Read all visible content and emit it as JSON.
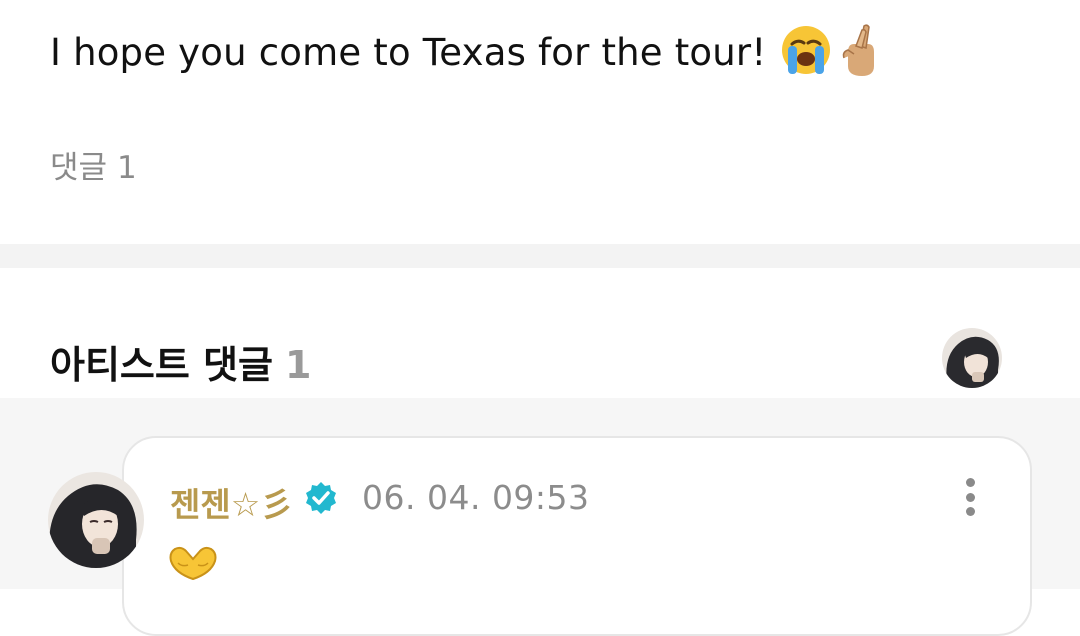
{
  "post": {
    "text": "I hope you come to Texas for the tour!",
    "emojis": [
      "loudly-crying-face-icon",
      "crossed-fingers-icon"
    ]
  },
  "comments_summary": {
    "label": "댓글",
    "count": "1"
  },
  "artist_comments": {
    "title": "아티스트 댓글",
    "count": "1"
  },
  "comment": {
    "author": "젠젠☆彡",
    "timestamp": "06. 04. 09:53",
    "content_emoji": "heart-hands-icon",
    "author_color": "#b89a4e"
  },
  "colors": {
    "verified_badge": "#22b8cf",
    "band_background": "#f3f3f3",
    "thread_background": "#f6f6f6"
  }
}
